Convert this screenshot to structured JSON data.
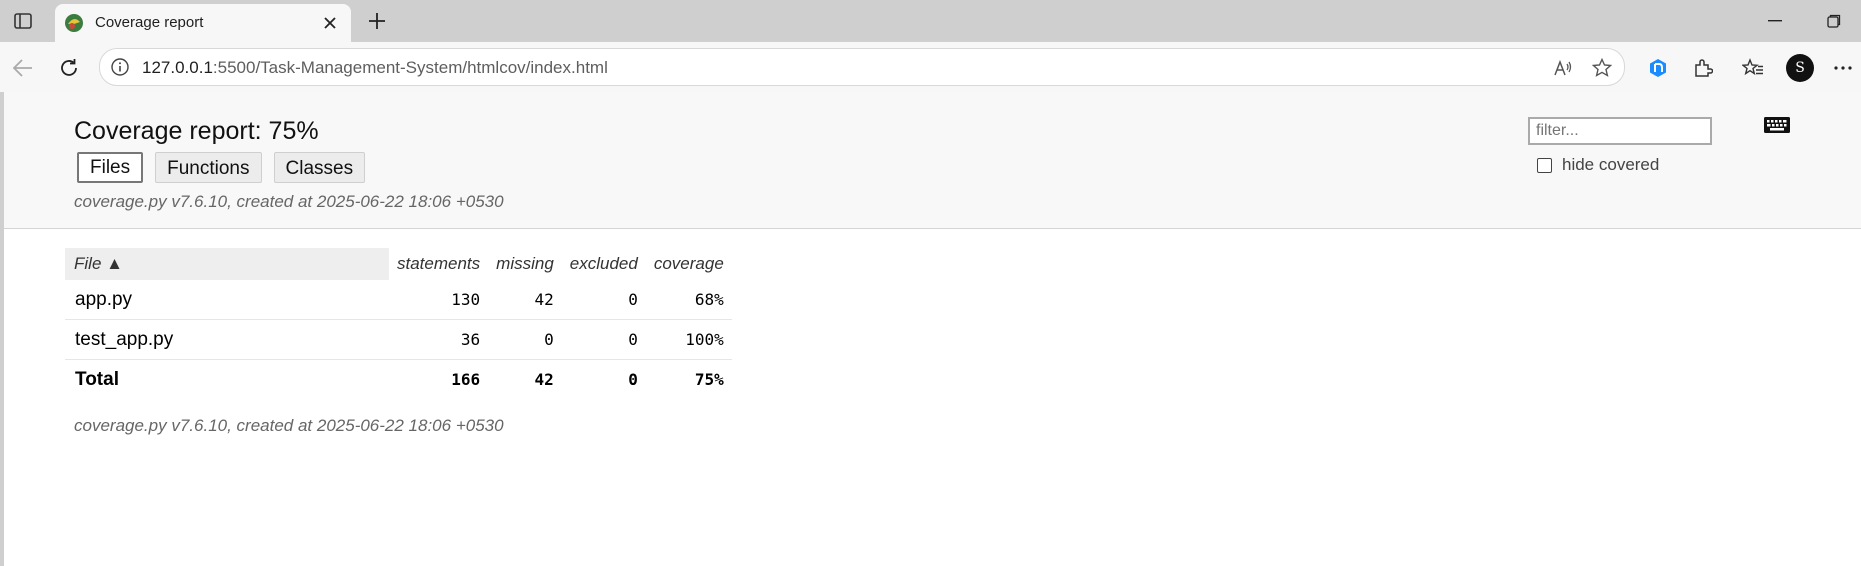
{
  "browser": {
    "tab": {
      "title": "Coverage report",
      "favicon": "coverage-favicon-icon"
    },
    "address": {
      "host": "127.0.0.1",
      "rest": ":5500/Task-Management-System/htmlcov/index.html"
    },
    "profile_initial": "S"
  },
  "header": {
    "title": "Coverage report: 75%",
    "nav": {
      "files": "Files",
      "functions": "Functions",
      "classes": "Classes"
    },
    "created": "coverage.py v7.6.10, created at 2025-06-22 18:06 +0530",
    "filter_placeholder": "filter...",
    "hide_covered": "hide covered"
  },
  "table": {
    "columns": [
      "File ▲",
      "statements",
      "missing",
      "excluded",
      "coverage"
    ],
    "rows": [
      {
        "file": "app.py",
        "statements": "130",
        "missing": "42",
        "excluded": "0",
        "coverage": "68%"
      },
      {
        "file": "test_app.py",
        "statements": "36",
        "missing": "0",
        "excluded": "0",
        "coverage": "100%"
      }
    ],
    "total": {
      "file": "Total",
      "statements": "166",
      "missing": "42",
      "excluded": "0",
      "coverage": "75%"
    }
  },
  "footer": {
    "created": "coverage.py v7.6.10, created at 2025-06-22 18:06 +0530"
  }
}
